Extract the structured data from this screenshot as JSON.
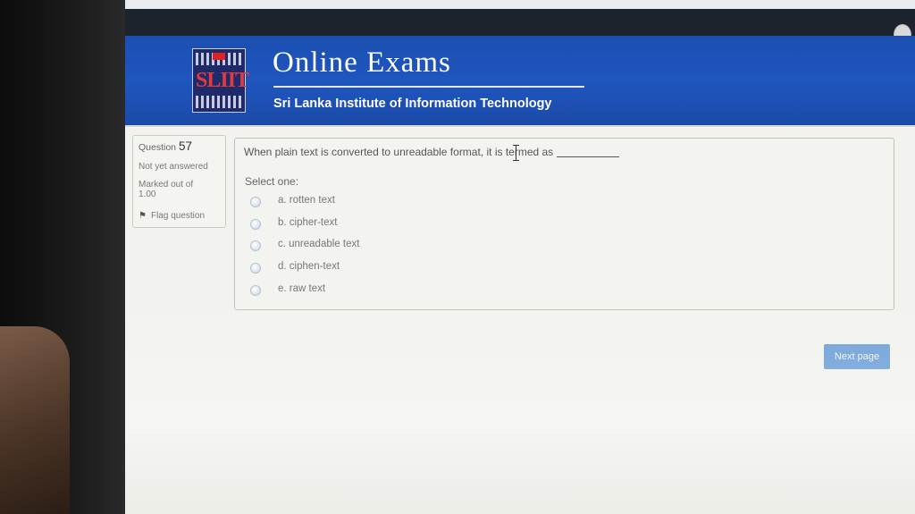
{
  "header": {
    "logo_text": "SLIIT",
    "title": "Online Exams",
    "subtitle": "Sri Lanka Institute of Information Technology"
  },
  "question_info": {
    "label": "Question",
    "number": "57",
    "state": "Not yet answered",
    "mark_line1": "Marked out of",
    "mark_line2": "1.00",
    "flag_label": "Flag question"
  },
  "question": {
    "text": "When plain text is converted to unreadable format, it is termed as",
    "select_label": "Select one:",
    "options": [
      {
        "label": "a. rotten text"
      },
      {
        "label": "b. cipher-text"
      },
      {
        "label": "c. unreadable text"
      },
      {
        "label": "d. ciphen-text"
      },
      {
        "label": "e. raw text"
      }
    ]
  },
  "navigation": {
    "next_label": "Next page"
  },
  "icons": {
    "flag": "flag-icon",
    "avatar": "user-avatar-icon"
  },
  "colors": {
    "banner": "#1f56bf",
    "next_button": "#6fa0d8"
  }
}
